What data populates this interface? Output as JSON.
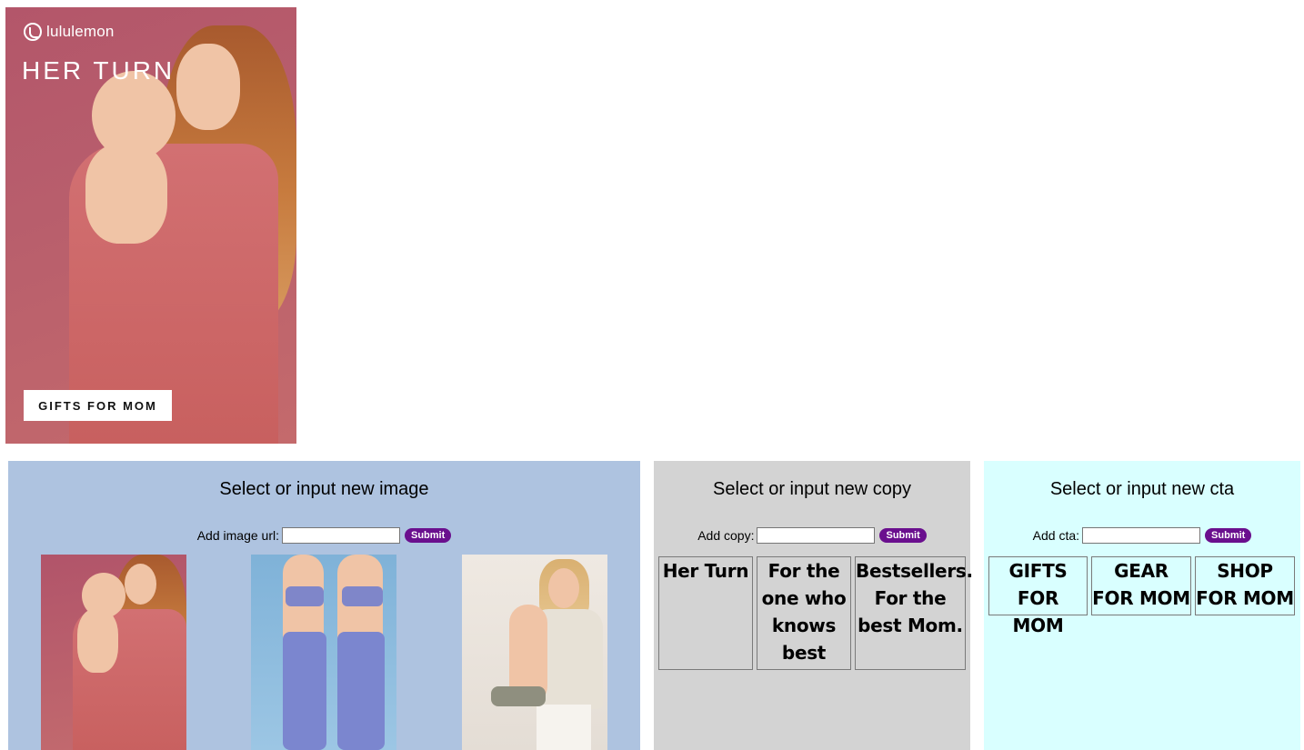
{
  "ad": {
    "brand": "lululemon",
    "headline": "HER TURN",
    "cta": "GIFTS FOR MOM",
    "background_color": "#b85e6c"
  },
  "image_panel": {
    "title": "Select or input new image",
    "input_label": "Add image url:",
    "input_value": "",
    "submit_label": "Submit",
    "background_color": "#aec3e0",
    "thumbnails": [
      {
        "icon": "mother-holding-baby-image"
      },
      {
        "icon": "two-women-activewear-image"
      },
      {
        "icon": "mother-and-child-image"
      }
    ]
  },
  "copy_panel": {
    "title": "Select or input new copy",
    "input_label": "Add copy:",
    "input_value": "",
    "submit_label": "Submit",
    "background_color": "#d3d3d3",
    "options": [
      "Her Turn",
      "For the one who knows best",
      "Bestsellers. For the best Mom."
    ]
  },
  "cta_panel": {
    "title": "Select or input new cta",
    "input_label": "Add cta:",
    "input_value": "",
    "submit_label": "Submit",
    "background_color": "#d9ffff",
    "options": [
      "GIFTS FOR MOM",
      "GEAR FOR MOM",
      "SHOP FOR MOM"
    ]
  },
  "colors": {
    "submit_button": "#6a0f8e"
  }
}
